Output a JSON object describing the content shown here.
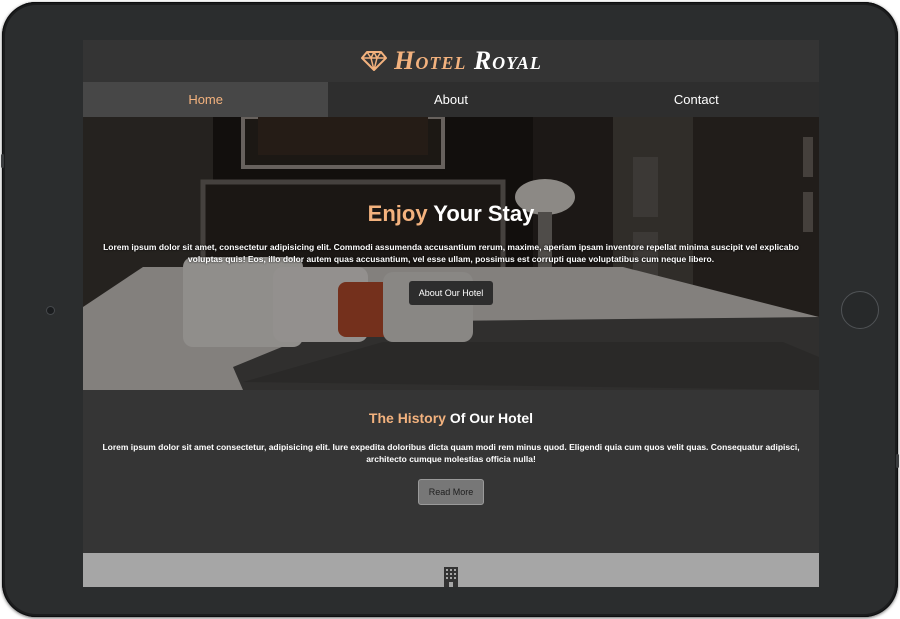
{
  "brand": {
    "name_part1": "Hotel",
    "name_part2": "Royal",
    "icon": "diamond-icon",
    "accent_color": "#f3b27e"
  },
  "nav": {
    "items": [
      {
        "label": "Home",
        "active": true
      },
      {
        "label": "About",
        "active": false
      },
      {
        "label": "Contact",
        "active": false
      }
    ]
  },
  "hero": {
    "title_accent": "Enjoy",
    "title_rest": "Your Stay",
    "text": "Lorem ipsum dolor sit amet, consectetur adipisicing elit. Commodi assumenda accusantium rerum, maxime, aperiam ipsam inventore repellat minima suscipit vel explicabo voluptas quis! Eos, illo dolor autem quas accusantium, vel esse ullam, possimus est corrupti quae voluptatibus cum neque libero.",
    "button_label": "About Our Hotel"
  },
  "history": {
    "title_accent": "The History",
    "title_rest": "Of Our Hotel",
    "text": "Lorem ipsum dolor sit amet consectetur, adipisicing elit. Iure expedita doloribus dicta quam modi rem minus quod. Eligendi quia cum quos velit quas. Consequatur adipisci, architecto cumque molestias officia nulla!",
    "button_label": "Read More"
  },
  "footer": {
    "icon": "building-icon"
  },
  "device": {
    "home_button_icon": "home-button",
    "camera_icon": "camera-icon"
  }
}
